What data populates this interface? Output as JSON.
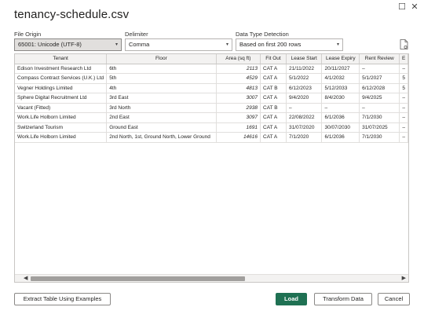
{
  "window": {
    "title": "tenancy-schedule.csv",
    "restore_glyph": "☐",
    "close_glyph": "✕"
  },
  "options": {
    "file_origin": {
      "label": "File Origin",
      "value": "65001: Unicode (UTF-8)"
    },
    "delimiter": {
      "label": "Delimiter",
      "value": "Comma"
    },
    "type_detection": {
      "label": "Data Type Detection",
      "value": "Based on first 200 rows"
    }
  },
  "table": {
    "columns": [
      "Tenant",
      "Floor",
      "Area (sq ft)",
      "Fit Out",
      "Lease Start",
      "Lease Expiry",
      "Rent Review",
      "E"
    ],
    "rows": [
      [
        "Edison Investment Research Ltd",
        "6th",
        "2113",
        "CAT A",
        "21/11/2022",
        "20/11/2027",
        "–",
        "–"
      ],
      [
        "Compass Contract Services (U.K.) Ltd",
        "5th",
        "4529",
        "CAT A",
        "5/1/2022",
        "4/1/2032",
        "5/1/2027",
        "5"
      ],
      [
        "Vegner Holdings Limited",
        "4th",
        "4813",
        "CAT B",
        "6/12/2023",
        "5/12/2033",
        "6/12/2028",
        "5"
      ],
      [
        "Sphere Digital Recruitment Ltd",
        "3rd East",
        "3007",
        "CAT A",
        "9/4/2020",
        "8/4/2030",
        "9/4/2025",
        "–"
      ],
      [
        "Vacant (Fitted)",
        "3rd North",
        "2938",
        "CAT B",
        "–",
        "–",
        "–",
        "–"
      ],
      [
        "Work.Life Holborn Limited",
        "2nd East",
        "3097",
        "CAT A",
        "22/08/2022",
        "6/1/2036",
        "7/1/2030",
        "–"
      ],
      [
        "Switzerland Tourism",
        "Ground East",
        "1691",
        "CAT A",
        "31/07/2020",
        "30/07/2030",
        "31/07/2025",
        "–"
      ],
      [
        "Work.Life Holborn Limited",
        "2nd North, 1st, Ground North, Lower Ground",
        "14616",
        "CAT A",
        "7/1/2020",
        "6/1/2036",
        "7/1/2030",
        "–"
      ]
    ]
  },
  "footer": {
    "extract_label": "Extract Table Using Examples",
    "load_label": "Load",
    "transform_label": "Transform Data",
    "cancel_label": "Cancel"
  },
  "colors": {
    "primary": "#1f7153",
    "grid_header": "#f3f2f1"
  }
}
